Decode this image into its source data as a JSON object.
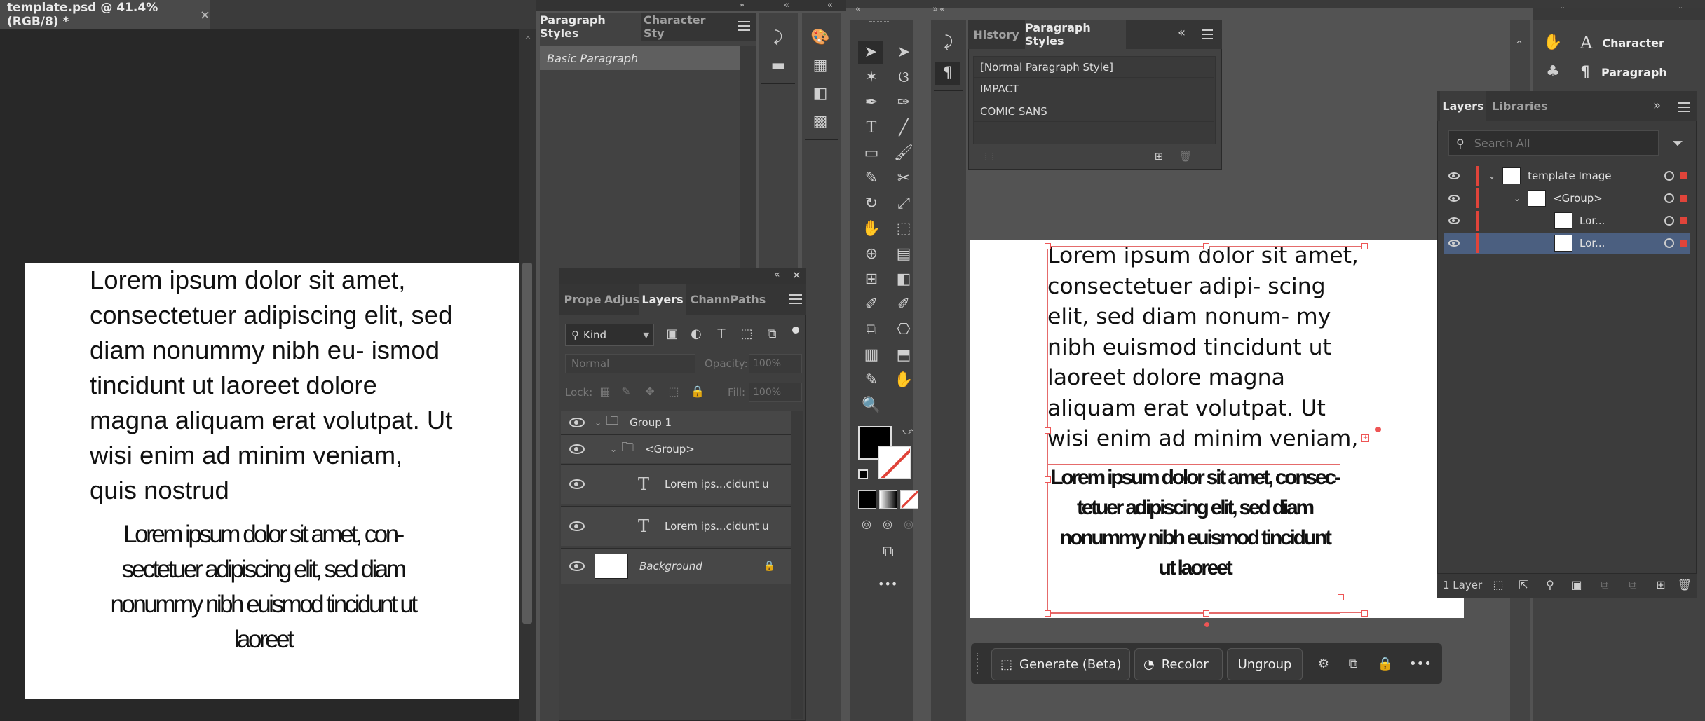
{
  "photoshop": {
    "doc_tab": "template.psd @ 41.4% (RGB/8) *",
    "close_glyph": "×",
    "canvas_text_regular": "Lorem ipsum dolor sit amet, consectetuer adipiscing elit, sed diam nonummy nibh eu- ismod tincidunt ut laoreet dolore magna aliquam erat volutpat. Ut wisi enim ad minim veniam, quis nostrud",
    "canvas_text_condensed": "Lorem ipsum dolor sit amet, con- sectetuer adipiscing elit, sed diam nonummy nibh euismod tincidunt ut laoreet",
    "paragraph_panel": {
      "tab_active": "Paragraph Styles",
      "tab_other": "Character Sty",
      "item": "Basic Paragraph"
    },
    "layers_panel": {
      "tabs": [
        "Prope",
        "Adjus",
        "Layers",
        "Chann",
        "Paths"
      ],
      "filter_kind": "Kind",
      "blend_mode": "Normal",
      "opacity_label": "Opacity:",
      "opacity_value": "100%",
      "lock_label": "Lock:",
      "fill_label": "Fill:",
      "fill_value": "100%",
      "layers": [
        {
          "name": "Group 1"
        },
        {
          "name": "<Group>"
        },
        {
          "name": "Lorem ips...cidunt u"
        },
        {
          "name": "Lorem ips...cidunt u"
        },
        {
          "name": "Background"
        }
      ]
    }
  },
  "illustrator": {
    "history_tab": "History",
    "paragraph_styles_tab": "Paragraph Styles",
    "styles": [
      "[Normal Paragraph Style]",
      "IMPACT",
      "COMIC SANS"
    ],
    "canvas_text_comic": "Lorem ipsum dolor sit amet, consectetuer adipi- scing elit, sed diam nonum- my nibh euismod tincidunt ut laoreet dolore magna aliquam erat volutpat. Ut wisi enim ad minim veniam,",
    "canvas_text_impact": "Lorem ipsum dolor sit amet, consec- tetuer adipiscing elit, sed diam nonummy nibh euismod tincidunt ut laoreet",
    "character_label": "Character",
    "paragraph_label": "Paragraph",
    "layers_tab": "Layers",
    "libraries_tab": "Libraries",
    "search_placeholder": "Search All",
    "layers": [
      {
        "name": "template Image"
      },
      {
        "name": "<Group>"
      },
      {
        "name": "Lor..."
      },
      {
        "name": "Lor..."
      }
    ],
    "layer_count": "1 Layer",
    "context_bar": {
      "generate": "Generate (Beta)",
      "recolor": "Recolor",
      "ungroup": "Ungroup",
      "more": "•••"
    },
    "toolbar_more": "•••",
    "accent_red": "#e0443a",
    "selection_blue": "#4b5f80"
  }
}
